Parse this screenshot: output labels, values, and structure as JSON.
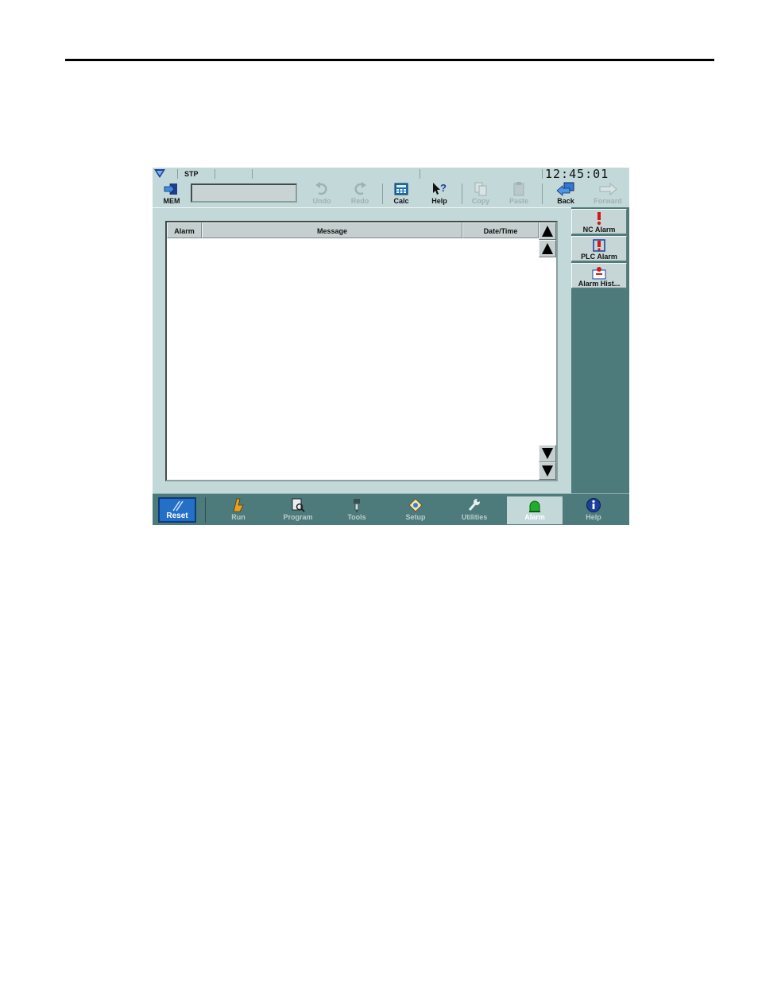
{
  "status": {
    "mode": "STP",
    "clock": "12:45:01"
  },
  "toolbar": {
    "mem_label": "MEM",
    "entry_value": "",
    "undo_label": "Undo",
    "redo_label": "Redo",
    "calc_label": "Calc",
    "help_label": "Help",
    "copy_label": "Copy",
    "paste_label": "Paste",
    "back_label": "Back",
    "forward_label": "Forward"
  },
  "table": {
    "columns": [
      "Alarm",
      "Message",
      "Date/Time"
    ],
    "rows": []
  },
  "side": {
    "items": [
      {
        "label": "NC Alarm"
      },
      {
        "label": "PLC Alarm"
      },
      {
        "label": "Alarm Hist..."
      }
    ]
  },
  "nav": {
    "reset_label": "Reset",
    "items": [
      {
        "label": "Run"
      },
      {
        "label": "Program"
      },
      {
        "label": "Tools"
      },
      {
        "label": "Setup"
      },
      {
        "label": "Utilities"
      },
      {
        "label": "Alarm",
        "active": true
      },
      {
        "label": "Help"
      }
    ]
  },
  "colors": {
    "panel": "#c3d8d8",
    "sidebar": "#4d7b7b",
    "reset": "#2570c7",
    "alarm_icon": "#d01818"
  }
}
